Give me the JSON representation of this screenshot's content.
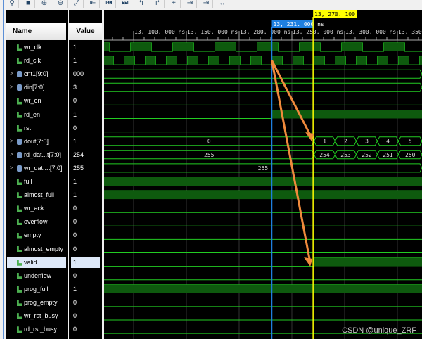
{
  "toolbar": {
    "icons": [
      "search-icon",
      "stop-icon",
      "zoom-in-icon",
      "zoom-out-icon",
      "zoom-fit-icon",
      "cursor-icon",
      "go-start-icon",
      "go-end-icon",
      "prev-transition-icon",
      "next-transition-icon",
      "add-marker-icon",
      "prev-marker-icon",
      "next-marker-icon",
      "swap-cursors-icon"
    ]
  },
  "headers": {
    "name": "Name",
    "value": "Value"
  },
  "cursors": {
    "main": "13, 270. 100 ns",
    "main_time": 13270.1,
    "secondary": "13, 231. 000 ns",
    "secondary_time": 13231,
    "colors": {
      "main": "#ffff00",
      "secondary": "#1e7fe0"
    }
  },
  "timeline": {
    "start": 13072,
    "end": 13373,
    "ticks": [
      {
        "t": 13100,
        "label": "13, 100. 000 ns"
      },
      {
        "t": 13150,
        "label": "13, 150. 000 ns"
      },
      {
        "t": 13200,
        "label": "13, 200. 000 ns"
      },
      {
        "t": 13250,
        "label": "13, 250. 000 ns"
      },
      {
        "t": 13300,
        "label": "13, 300. 000 ns"
      },
      {
        "t": 13350,
        "label": "13, 350."
      }
    ]
  },
  "signals": [
    {
      "name": "wr_clk",
      "value": "1",
      "type": "bit",
      "clock": {
        "period": 40,
        "rise": 13097
      }
    },
    {
      "name": "rd_clk",
      "value": "1",
      "type": "bit",
      "clock": {
        "period": 20,
        "rise": 13231
      }
    },
    {
      "name": "cnt1[9:0]",
      "value": "000",
      "type": "bus",
      "segments": [
        {
          "t": 13072,
          "v": ""
        }
      ]
    },
    {
      "name": "din[7:0]",
      "value": "3",
      "type": "bus",
      "segments": [
        {
          "t": 13072,
          "v": ""
        }
      ]
    },
    {
      "name": "wr_en",
      "value": "0",
      "type": "bit",
      "init": 0,
      "edges": []
    },
    {
      "name": "rd_en",
      "value": "1",
      "type": "bit",
      "init": 0,
      "edges": [
        [
          13231,
          1
        ]
      ]
    },
    {
      "name": "rst",
      "value": "0",
      "type": "bit",
      "init": 0,
      "edges": []
    },
    {
      "name": "dout[7:0]",
      "value": "1",
      "type": "bus",
      "segments": [
        {
          "t": 13072,
          "v": "0"
        },
        {
          "t": 13271,
          "v": "1"
        },
        {
          "t": 13291,
          "v": "2"
        },
        {
          "t": 13311,
          "v": "3"
        },
        {
          "t": 13331,
          "v": "4"
        },
        {
          "t": 13351,
          "v": "5"
        }
      ]
    },
    {
      "name": "rd_dat...t[7:0]",
      "value": "254",
      "type": "bus",
      "segments": [
        {
          "t": 13072,
          "v": "255"
        },
        {
          "t": 13271,
          "v": "254"
        },
        {
          "t": 13291,
          "v": "253"
        },
        {
          "t": 13311,
          "v": "252"
        },
        {
          "t": 13331,
          "v": "251"
        },
        {
          "t": 13351,
          "v": "250"
        }
      ]
    },
    {
      "name": "wr_dat...t[7:0]",
      "value": "255",
      "type": "bus",
      "segments": [
        {
          "t": 13072,
          "v": "255"
        }
      ]
    },
    {
      "name": "full",
      "value": "1",
      "type": "bit",
      "init": 1,
      "edges": []
    },
    {
      "name": "almost_full",
      "value": "1",
      "type": "bit",
      "init": 1,
      "edges": []
    },
    {
      "name": "wr_ack",
      "value": "0",
      "type": "bit",
      "init": 0,
      "edges": []
    },
    {
      "name": "overflow",
      "value": "0",
      "type": "bit",
      "init": 0,
      "edges": []
    },
    {
      "name": "empty",
      "value": "0",
      "type": "bit",
      "init": 0,
      "edges": []
    },
    {
      "name": "almost_empty",
      "value": "0",
      "type": "bit",
      "init": 0,
      "edges": []
    },
    {
      "name": "valid",
      "value": "1",
      "type": "bit",
      "init": 0,
      "edges": [
        [
          13271,
          1
        ]
      ],
      "selected": true
    },
    {
      "name": "underflow",
      "value": "0",
      "type": "bit",
      "init": 0,
      "edges": []
    },
    {
      "name": "prog_full",
      "value": "1",
      "type": "bit",
      "init": 1,
      "edges": []
    },
    {
      "name": "prog_empty",
      "value": "0",
      "type": "bit",
      "init": 0,
      "edges": []
    },
    {
      "name": "wr_rst_busy",
      "value": "0",
      "type": "bit",
      "init": 0,
      "edges": []
    },
    {
      "name": "rd_rst_busy",
      "value": "0",
      "type": "bit",
      "init": 0,
      "edges": []
    }
  ],
  "annotation_color": "#f08a3c",
  "watermark": "CSDN @unique_ZRF"
}
